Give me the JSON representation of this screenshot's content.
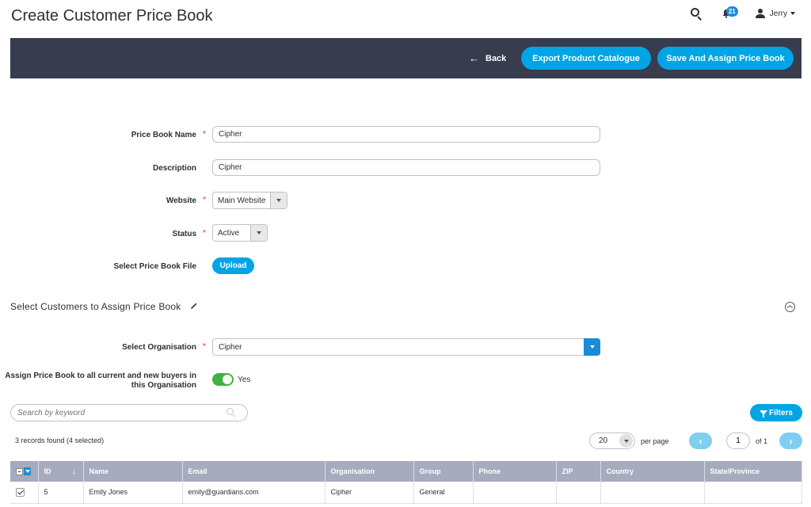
{
  "page": {
    "title": "Create Customer Price Book"
  },
  "header": {
    "notifications_count": "21",
    "user_name": "Jerry"
  },
  "toolbar": {
    "back_label": "Back",
    "export_label": "Export Product Catalogue",
    "save_label": "Save And Assign Price Book",
    "color": "#373c4f",
    "accent": "#00a5e6"
  },
  "form": {
    "price_book_name": {
      "label": "Price Book Name",
      "value": "Cipher",
      "required": true
    },
    "description": {
      "label": "Description",
      "value": "Cipher"
    },
    "website": {
      "label": "Website",
      "value": "Main Website",
      "required": true
    },
    "status": {
      "label": "Status",
      "value": "Active",
      "required": true
    },
    "price_book_file": {
      "label": "Select Price Book File",
      "button": "Upload"
    }
  },
  "customers_section": {
    "title": "Select Customers to Assign Price Book",
    "organisation": {
      "label": "Select Organisation",
      "value": "Cipher",
      "required": true
    },
    "assign_all": {
      "label": "Assign Price Book to all current and new buyers in this Organisation",
      "toggle_text": "Yes",
      "on": true
    }
  },
  "grid_controls": {
    "search_placeholder": "Search by keyword",
    "filters_label": "Filters",
    "records_text": "3 records found (4 selected)",
    "per_page_value": "20",
    "per_page_label": "per page",
    "current_page": "1",
    "total_pages_text": "of 1"
  },
  "grid": {
    "columns": [
      "ID",
      "Name",
      "Email",
      "Organisation",
      "Group",
      "Phone",
      "ZIP",
      "Country",
      "State/Province"
    ],
    "rows": [
      {
        "checked": true,
        "id": "5",
        "name": "Emily Jones",
        "email": "emily@guardians.com",
        "organisation": "Cipher",
        "group": "General",
        "phone": "",
        "zip": "",
        "country": "",
        "state": ""
      }
    ]
  }
}
